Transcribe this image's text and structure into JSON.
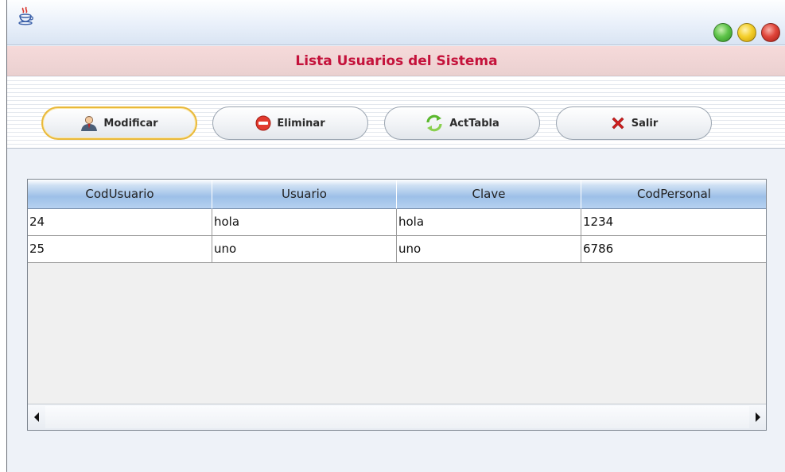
{
  "window": {
    "title": "Lista Usuarios del Sistema",
    "app_icon": "java-coffee-icon",
    "controls": [
      "minimize",
      "maximize",
      "close"
    ],
    "colors": {
      "title_text": "#c4123b",
      "header_band": "#f3d6d6",
      "focus_ring": "#e9b93a"
    }
  },
  "toolbar": {
    "buttons": [
      {
        "label": "Modificar",
        "icon": "user-icon",
        "focused": true
      },
      {
        "label": "Eliminar",
        "icon": "minus-circle-icon",
        "focused": false
      },
      {
        "label": "ActTabla",
        "icon": "refresh-icon",
        "focused": false
      },
      {
        "label": "Salir",
        "icon": "close-x-icon",
        "focused": false
      }
    ]
  },
  "table": {
    "columns": [
      "CodUsuario",
      "Usuario",
      "Clave",
      "CodPersonal"
    ],
    "rows": [
      [
        "24",
        "hola",
        "hola",
        "1234"
      ],
      [
        "25",
        "uno",
        "uno",
        "6786"
      ]
    ]
  }
}
